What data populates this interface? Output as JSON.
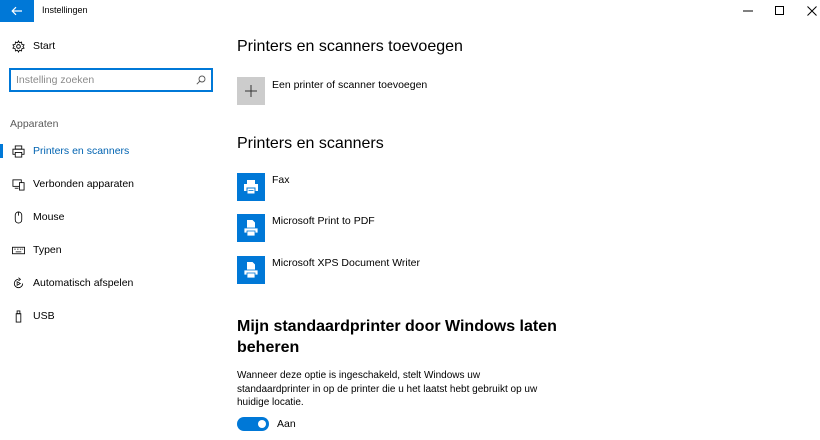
{
  "window": {
    "title": "Instellingen",
    "accent_color": "#0078d7"
  },
  "sidebar": {
    "home_label": "Start",
    "search": {
      "placeholder": "Instelling zoeken",
      "value": ""
    },
    "section_label": "Apparaten",
    "items": [
      {
        "label": "Printers en scanners",
        "icon": "printer-icon",
        "active": true
      },
      {
        "label": "Verbonden apparaten",
        "icon": "connected-devices-icon",
        "active": false
      },
      {
        "label": "Mouse",
        "icon": "mouse-icon",
        "active": false
      },
      {
        "label": "Typen",
        "icon": "keyboard-icon",
        "active": false
      },
      {
        "label": "Automatisch afspelen",
        "icon": "autoplay-icon",
        "active": false
      },
      {
        "label": "USB",
        "icon": "usb-icon",
        "active": false
      }
    ]
  },
  "main": {
    "add_section": {
      "heading": "Printers en scanners toevoegen",
      "add_label": "Een printer of scanner toevoegen"
    },
    "list_section": {
      "heading": "Printers en scanners",
      "printers": [
        {
          "name": "Fax",
          "icon": "fax-icon"
        },
        {
          "name": "Microsoft Print to PDF",
          "icon": "document-printer-icon"
        },
        {
          "name": "Microsoft XPS Document Writer",
          "icon": "document-printer-icon"
        }
      ]
    },
    "default_section": {
      "heading": "Mijn standaardprinter door Windows laten beheren",
      "description": "Wanneer deze optie is ingeschakeld, stelt Windows uw standaardprinter in op de printer die u het laatst hebt gebruikt op uw huidige locatie.",
      "toggle_label": "Aan",
      "toggle_on": true
    }
  }
}
